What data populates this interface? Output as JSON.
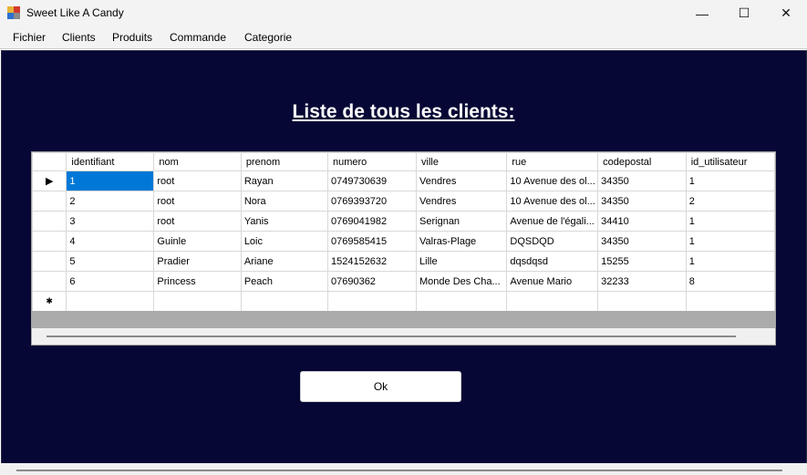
{
  "window": {
    "title": "Sweet Like A Candy",
    "icon": "app-icon",
    "controls": {
      "minimize": "—",
      "maximize": "☐",
      "close": "✕"
    }
  },
  "menu": [
    "Fichier",
    "Clients",
    "Produits",
    "Commande",
    "Categorie"
  ],
  "heading": "Liste de tous les clients:",
  "grid": {
    "columns": [
      "identifiant",
      "nom",
      "prenom",
      "numero",
      "ville",
      "rue",
      "codepostal",
      "id_utilisateur"
    ],
    "rows": [
      [
        "1",
        "root",
        "Rayan",
        "0749730639",
        "Vendres",
        "10 Avenue des ol...",
        "34350",
        "1"
      ],
      [
        "2",
        "root",
        "Nora",
        "0769393720",
        "Vendres",
        "10 Avenue des ol...",
        "34350",
        "2"
      ],
      [
        "3",
        "root",
        "Yanis",
        "0769041982",
        "Serignan",
        "Avenue de l'égali...",
        "34410",
        "1"
      ],
      [
        "4",
        "Guinle",
        "Loic",
        "0769585415",
        "Valras-Plage",
        "DQSDQD",
        "34350",
        "1"
      ],
      [
        "5",
        "Pradier",
        "Ariane",
        "1524152632",
        "Lille",
        "dqsdqsd",
        "15255",
        "1"
      ],
      [
        "6",
        "Princess",
        "Peach",
        "07690362",
        "Monde Des Cha...",
        "Avenue Mario",
        "32233",
        "8"
      ]
    ],
    "current_row_marker": "▶",
    "new_row_marker": "✱",
    "selected_cell": "1"
  },
  "ok_button": "Ok",
  "colors": {
    "background": "#070736",
    "selection": "#0078d7",
    "heading": "#ffffff"
  }
}
